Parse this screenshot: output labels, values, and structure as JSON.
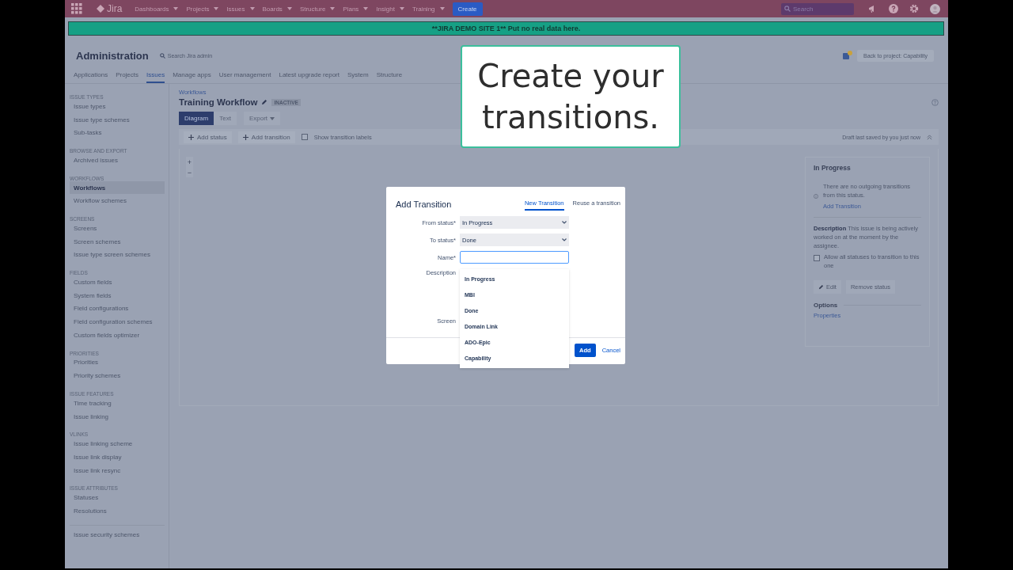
{
  "topbar": {
    "logo": "Jira",
    "menu": [
      "Dashboards",
      "Projects",
      "Issues",
      "Boards",
      "Structure",
      "Plans",
      "Insight",
      "Training"
    ],
    "create": "Create",
    "search": {
      "placeholder": "Search"
    }
  },
  "banner": "**JIRA DEMO SITE 1** Put no real data here.",
  "admin": {
    "title": "Administration",
    "search": {
      "placeholder": "Search Jira admin"
    },
    "back": "Back to project: Capability",
    "tabs": [
      {
        "label": "Applications",
        "selected": false
      },
      {
        "label": "Projects",
        "selected": false
      },
      {
        "label": "Issues",
        "selected": true
      },
      {
        "label": "Manage apps",
        "selected": false
      },
      {
        "label": "User management",
        "selected": false
      },
      {
        "label": "Latest upgrade report",
        "selected": false
      },
      {
        "label": "System",
        "selected": false
      },
      {
        "label": "Structure",
        "selected": false
      }
    ]
  },
  "sidebar": [
    {
      "heading": "ISSUE TYPES",
      "items": [
        {
          "label": "Issue types",
          "selected": false
        },
        {
          "label": "Issue type schemes",
          "selected": false
        },
        {
          "label": "Sub-tasks",
          "selected": false
        }
      ]
    },
    {
      "heading": "BROWSE AND EXPORT",
      "items": [
        {
          "label": "Archived issues",
          "selected": false
        }
      ]
    },
    {
      "heading": "WORKFLOWS",
      "items": [
        {
          "label": "Workflows",
          "selected": true
        },
        {
          "label": "Workflow schemes",
          "selected": false
        }
      ]
    },
    {
      "heading": "SCREENS",
      "items": [
        {
          "label": "Screens",
          "selected": false
        },
        {
          "label": "Screen schemes",
          "selected": false
        },
        {
          "label": "Issue type screen schemes",
          "selected": false
        }
      ]
    },
    {
      "heading": "FIELDS",
      "items": [
        {
          "label": "Custom fields",
          "selected": false
        },
        {
          "label": "System fields",
          "selected": false
        },
        {
          "label": "Field configurations",
          "selected": false
        },
        {
          "label": "Field configuration schemes",
          "selected": false
        },
        {
          "label": "Custom fields optimizer",
          "selected": false
        }
      ]
    },
    {
      "heading": "PRIORITIES",
      "items": [
        {
          "label": "Priorities",
          "selected": false
        },
        {
          "label": "Priority schemes",
          "selected": false
        }
      ]
    },
    {
      "heading": "ISSUE FEATURES",
      "items": [
        {
          "label": "Time tracking",
          "selected": false
        },
        {
          "label": "Issue linking",
          "selected": false
        }
      ]
    },
    {
      "heading": "VLINKS",
      "items": [
        {
          "label": "Issue linking scheme",
          "selected": false
        },
        {
          "label": "Issue link display",
          "selected": false
        },
        {
          "label": "Issue link resync",
          "selected": false
        }
      ]
    },
    {
      "heading": "ISSUE ATTRIBUTES",
      "items": [
        {
          "label": "Statuses",
          "selected": false
        },
        {
          "label": "Resolutions",
          "selected": false
        }
      ]
    },
    {
      "items": [
        {
          "label": "Issue security schemes",
          "selected": false
        }
      ]
    }
  ],
  "workflow": {
    "breadcrumb": "Workflows",
    "title": "Training Workflow",
    "badge": "INACTIVE",
    "views": [
      {
        "label": "Diagram",
        "selected": true
      },
      {
        "label": "Text",
        "selected": false
      }
    ],
    "export": "Export",
    "toolbar": {
      "add_status": "Add status",
      "add_transition": "Add transition",
      "show_labels": {
        "label": "Show transition labels",
        "checked": false
      },
      "draft": "Draft last saved by you just now"
    },
    "zoom": [
      "+",
      "−"
    ]
  },
  "panel": {
    "title": "In Progress",
    "notice": "There are no outgoing transitions from this status.",
    "notice_link": "Add Transition",
    "description_label": "Description",
    "description": "This issue is being actively worked on at the moment by the assignee.",
    "allow": {
      "label": "Allow all statuses to transition to this one",
      "checked": false
    },
    "edit": "Edit",
    "remove": "Remove status",
    "options": "Options",
    "properties": "Properties"
  },
  "callout": "Create your transitions.",
  "dialog": {
    "title": "Add Transition",
    "tabs": [
      {
        "label": "New Transition",
        "selected": true
      },
      {
        "label": "Reuse a transition",
        "selected": false
      }
    ],
    "from_status": {
      "label": "From status*",
      "value": "In Progress"
    },
    "to_status": {
      "label": "To status*",
      "value": "Done"
    },
    "name": {
      "label": "Name*"
    },
    "description": {
      "label": "Description"
    },
    "screen": {
      "label": "Screen"
    },
    "suggestions": [
      "In Progress",
      "MBI",
      "Done",
      "Domain Link",
      "ADO-Epic",
      "Capability"
    ],
    "add": "Add",
    "cancel": "Cancel"
  }
}
